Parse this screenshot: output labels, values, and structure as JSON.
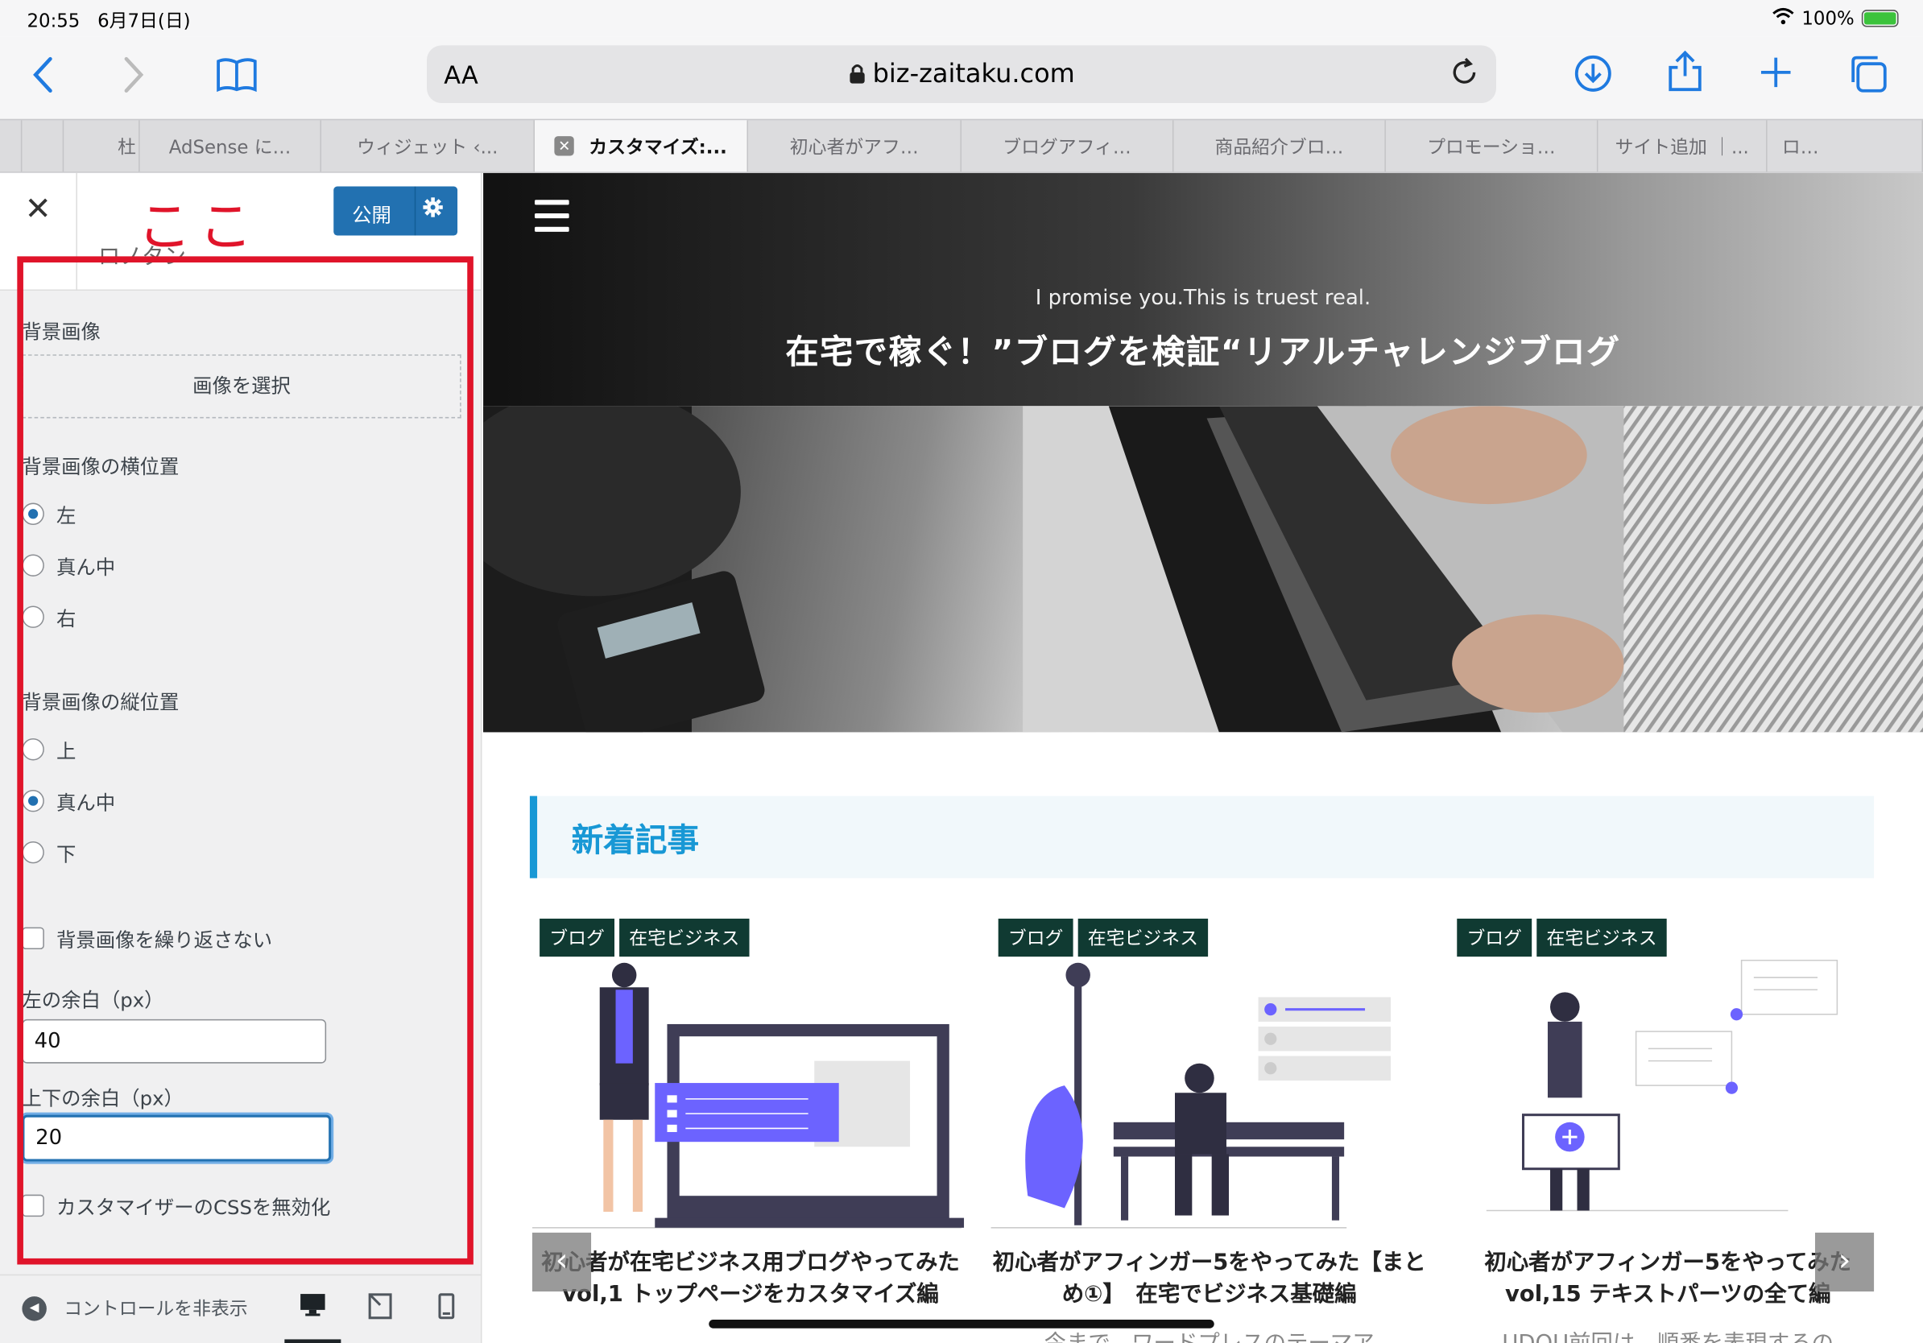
{
  "status": {
    "time": "20:55",
    "date": "6月7日(日)",
    "battery": "100%"
  },
  "browser": {
    "aa": "AA",
    "url": "biz-zaitaku.com",
    "tabs": [
      {
        "label": "AdSense に…"
      },
      {
        "label": "ウィジェット ‹..."
      },
      {
        "label": "カスタマイズ:..."
      },
      {
        "label": "初心者がアフ…"
      },
      {
        "label": "ブログアフィ…"
      },
      {
        "label": "商品紹介ブロ…"
      },
      {
        "label": "プロモーショ…"
      },
      {
        "label": "サイト追加 ｜..."
      },
      {
        "label": "ロ…"
      }
    ],
    "first_tab_fragment": "杜"
  },
  "customizer": {
    "annotation": "ここ",
    "publish_label": "公開",
    "section_subtitle": "ロノタン",
    "bg_image_label": "背景画像",
    "select_image_button": "画像を選択",
    "h_position_label": "背景画像の横位置",
    "h_options": [
      {
        "label": "左",
        "checked": true
      },
      {
        "label": "真ん中",
        "checked": false
      },
      {
        "label": "右",
        "checked": false
      }
    ],
    "v_position_label": "背景画像の縦位置",
    "v_options": [
      {
        "label": "上",
        "checked": false
      },
      {
        "label": "真ん中",
        "checked": true
      },
      {
        "label": "下",
        "checked": false
      }
    ],
    "no_repeat_label": "背景画像を繰り返さない",
    "left_margin_label": "左の余白（px）",
    "left_margin_value": "40",
    "vertical_margin_label": "上下の余白（px）",
    "vertical_margin_value": "20",
    "disable_css_label": "カスタマイザーのCSSを無効化",
    "hide_controls_label": "コントロールを非表示"
  },
  "site": {
    "tagline": "I promise you.This is truest real.",
    "title": "在宅で稼ぐ！”ブログを検証“リアルチャレンジブログ",
    "section_heading": "新着記事",
    "cards": [
      {
        "tags": [
          "ブログ",
          "在宅ビジネス"
        ],
        "title": "初心者が在宅ビジネス用ブログやってみた　vol,1 トップページをカスタマイズ編",
        "excerpt": ""
      },
      {
        "tags": [
          "ブログ",
          "在宅ビジネス"
        ],
        "title": "初心者がアフィンガー5をやってみた【まとめ①】　在宅でビジネス基礎編",
        "excerpt": "今まで、ワードプレスのテーマア"
      },
      {
        "tags": [
          "ブログ",
          "在宅ビジネス"
        ],
        "title": "初心者がアフィンガー5をやってみた　vol,15 テキストパーツの全て編",
        "excerpt": "UDOU前回は、順番を表現するの"
      }
    ]
  },
  "colors": {
    "accent": "#1f7ae0",
    "wp_blue": "#2271b1",
    "highlight_red": "#e0142a",
    "section_blue": "#1898d5",
    "tag_bg": "#103a32"
  }
}
